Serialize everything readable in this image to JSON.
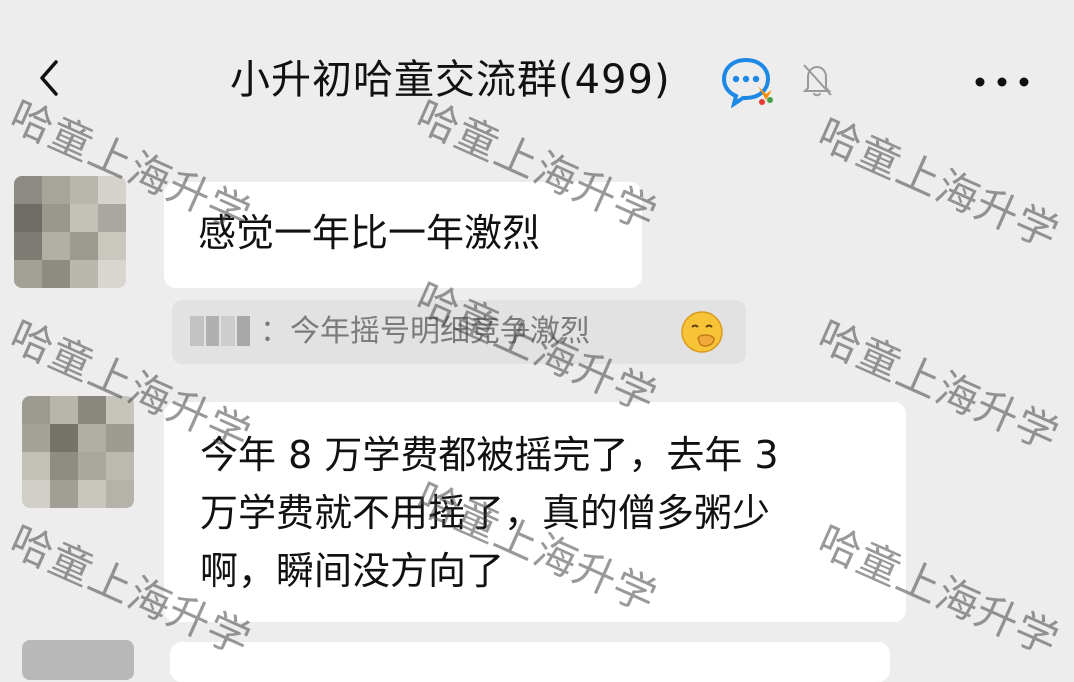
{
  "header": {
    "back_icon": "chevron-left-icon",
    "title": "小升初哈童交流群(499)",
    "brand_icon": "chat-bubble-logo-icon",
    "mute_icon": "bell-muted-icon",
    "more_icon": "more-dots-icon"
  },
  "messages": [
    {
      "text": "感觉一年比一年激烈"
    },
    {
      "quote": {
        "text": "：今年摇号明细竞争激烈",
        "emoji": "hand-over-mouth-emoji"
      }
    },
    {
      "lines": [
        "今年 8 万学费都被摇完了，去年 3",
        "万学费就不用摇了，真的僧多粥少",
        "啊，瞬间没方向了"
      ]
    }
  ],
  "watermark": {
    "text": "哈童上海升学"
  },
  "colors": {
    "background": "#ededed",
    "bubble": "#ffffff",
    "quote_bg": "#e2e2e2",
    "quote_text": "#7b7b7b"
  }
}
